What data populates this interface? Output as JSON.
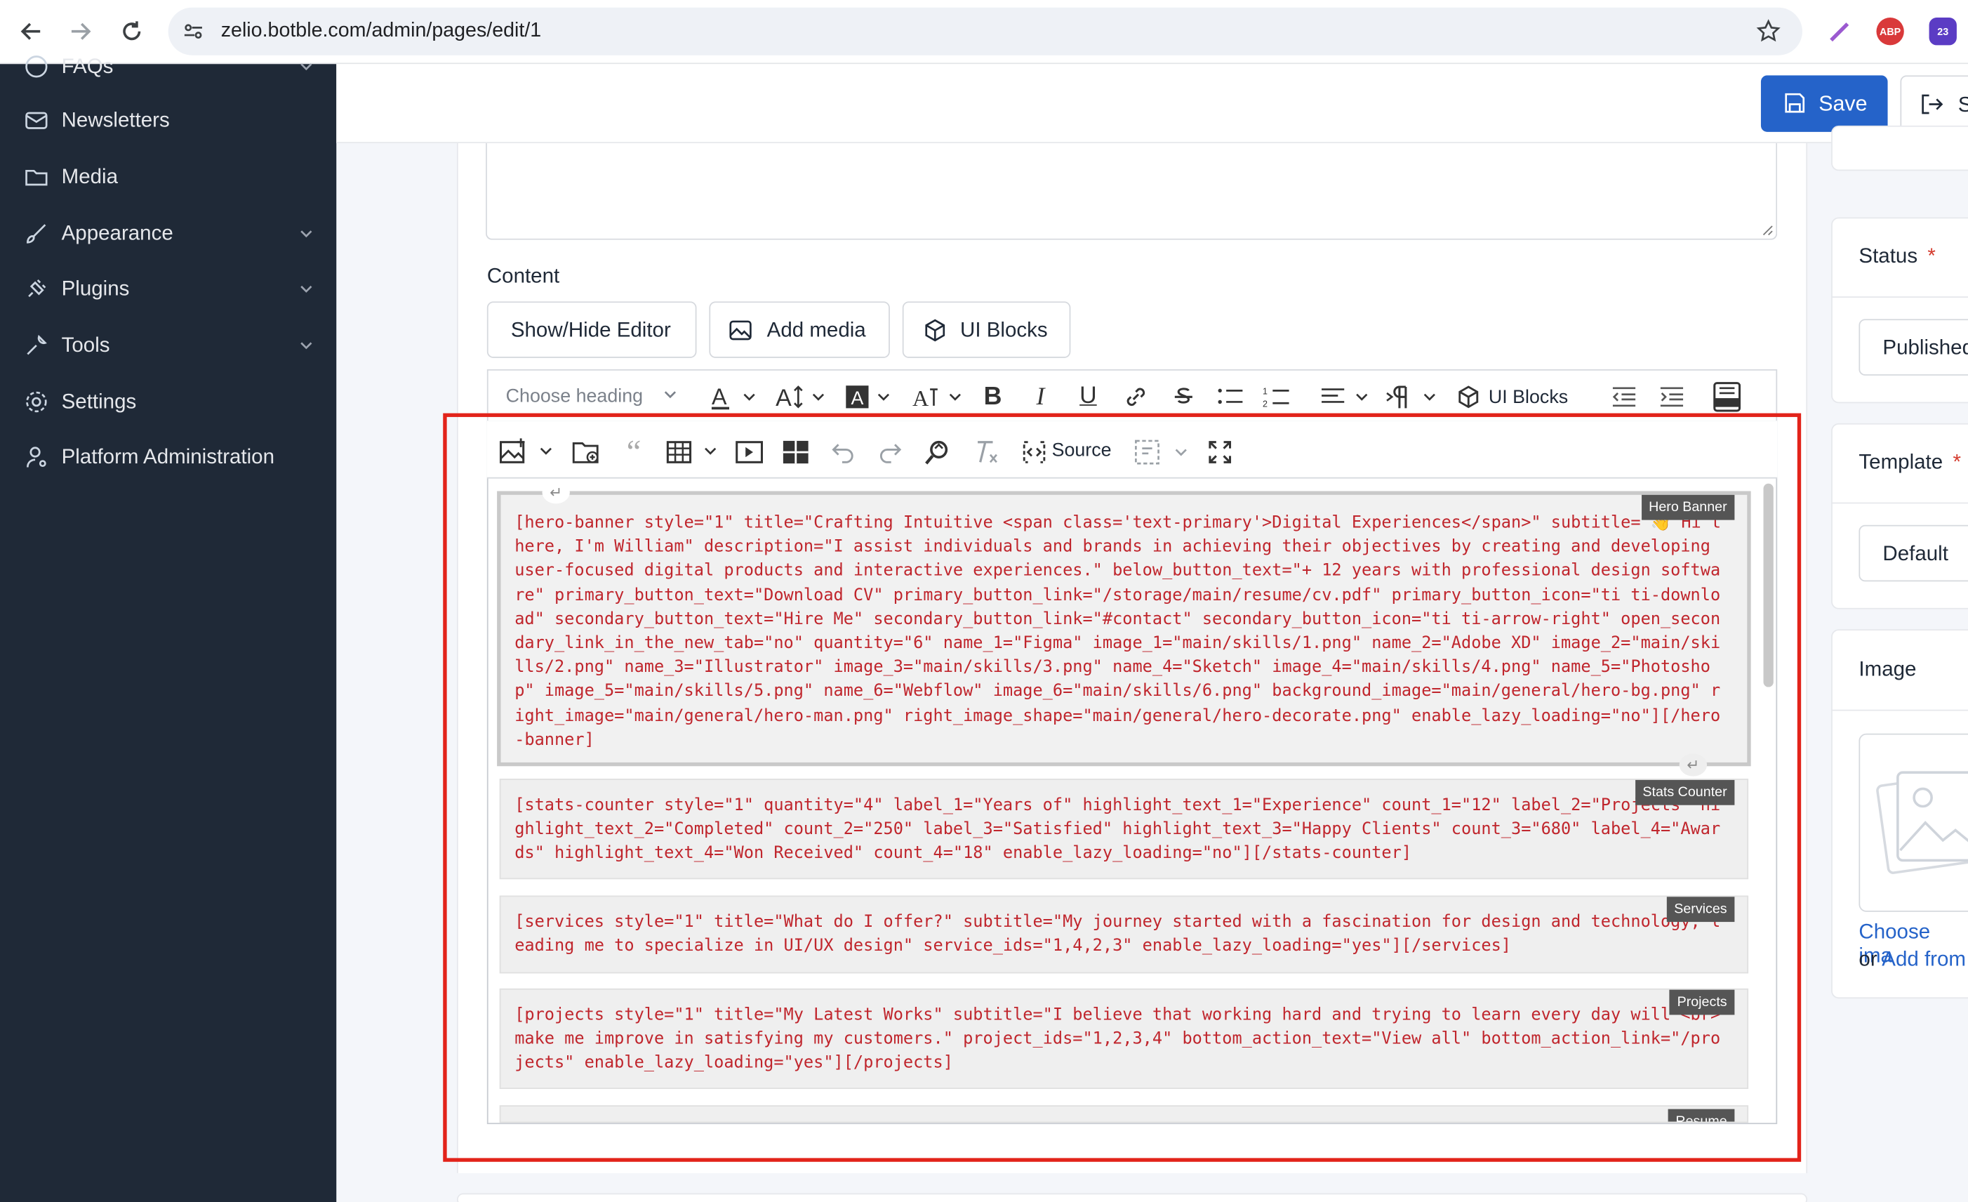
{
  "browser": {
    "url": "zelio.botble.com/admin/pages/edit/1",
    "ext_abp": "ABP",
    "ext_badge": "23"
  },
  "sidebar": {
    "items": [
      {
        "label": "FAQs",
        "icon": "question-circle-icon",
        "has_children": true
      },
      {
        "label": "Newsletters",
        "icon": "mail-icon",
        "has_children": false
      },
      {
        "label": "Media",
        "icon": "folder-icon",
        "has_children": false
      },
      {
        "label": "Appearance",
        "icon": "brush-icon",
        "has_children": true
      },
      {
        "label": "Plugins",
        "icon": "plug-icon",
        "has_children": true
      },
      {
        "label": "Tools",
        "icon": "wrench-icon",
        "has_children": true
      },
      {
        "label": "Settings",
        "icon": "gear-icon",
        "has_children": false
      },
      {
        "label": "Platform Administration",
        "icon": "user-cog-icon",
        "has_children": false
      }
    ]
  },
  "header": {
    "save_label": "Save",
    "save_exit_label": "S"
  },
  "content": {
    "label": "Content",
    "buttons": {
      "show_hide": "Show/Hide Editor",
      "add_media": "Add media",
      "ui_blocks": "UI Blocks"
    },
    "toolbar": {
      "heading_placeholder": "Choose heading",
      "ui_blocks": "UI Blocks",
      "source": "Source"
    },
    "blocks": [
      {
        "tag": "Hero Banner",
        "text": "[hero-banner style=\"1\" title=\"Crafting Intuitive <span class='text-primary'>Digital Experiences</span>\" subtitle=\"👋 Hi there, I'm William\" description=\"I assist individuals and brands in achieving their objectives by creating and developing user-focused digital products and interactive experiences.\" below_button_text=\"+ 12 years with professional design software\" primary_button_text=\"Download CV\" primary_button_link=\"/storage/main/resume/cv.pdf\" primary_button_icon=\"ti ti-download\" secondary_button_text=\"Hire Me\" secondary_button_link=\"#contact\" secondary_button_icon=\"ti ti-arrow-right\" open_secondary_link_in_the_new_tab=\"no\" quantity=\"6\" name_1=\"Figma\" image_1=\"main/skills/1.png\" name_2=\"Adobe XD\" image_2=\"main/skills/2.png\" name_3=\"Illustrator\" image_3=\"main/skills/3.png\" name_4=\"Sketch\" image_4=\"main/skills/4.png\" name_5=\"Photoshop\" image_5=\"main/skills/5.png\" name_6=\"Webflow\" image_6=\"main/skills/6.png\" background_image=\"main/general/hero-bg.png\" right_image=\"main/general/hero-man.png\" right_image_shape=\"main/general/hero-decorate.png\" enable_lazy_loading=\"no\"][/hero-banner]"
      },
      {
        "tag": "Stats Counter",
        "text": "[stats-counter style=\"1\" quantity=\"4\" label_1=\"Years of\" highlight_text_1=\"Experience\" count_1=\"12\" label_2=\"Projects\" highlight_text_2=\"Completed\" count_2=\"250\" label_3=\"Satisfied\" highlight_text_3=\"Happy Clients\" count_3=\"680\" label_4=\"Awards\" highlight_text_4=\"Won Received\" count_4=\"18\" enable_lazy_loading=\"no\"][/stats-counter]"
      },
      {
        "tag": "Services",
        "text": "[services style=\"1\" title=\"What do I offer?\" subtitle=\"My journey started with a fascination for design and technology, leading me to specialize in UI/UX design\" service_ids=\"1,4,2,3\" enable_lazy_loading=\"yes\"][/services]"
      },
      {
        "tag": "Projects",
        "text": "[projects style=\"1\" title=\"My Latest Works\" subtitle=\"I believe that working hard and trying to learn every day will <br> make me improve in satisfying my customers.\" project_ids=\"1,2,3,4\" bottom_action_text=\"View all\" bottom_action_link=\"/projects\" enable_lazy_loading=\"yes\"][/projects]"
      },
      {
        "tag": "Resume",
        "text": ""
      }
    ]
  },
  "right_panel": {
    "status_title": "Status",
    "status_value": "Published",
    "template_title": "Template",
    "template_value": "Default",
    "image_title": "Image",
    "choose_image": "Choose ima",
    "or_add_from_prefix": "or ",
    "or_add_from": "Add from"
  },
  "colors": {
    "sidebar_bg": "#1f2937",
    "primary": "#2563c9",
    "shortcode_text": "#c0262d",
    "highlight_border": "#e2231a"
  }
}
